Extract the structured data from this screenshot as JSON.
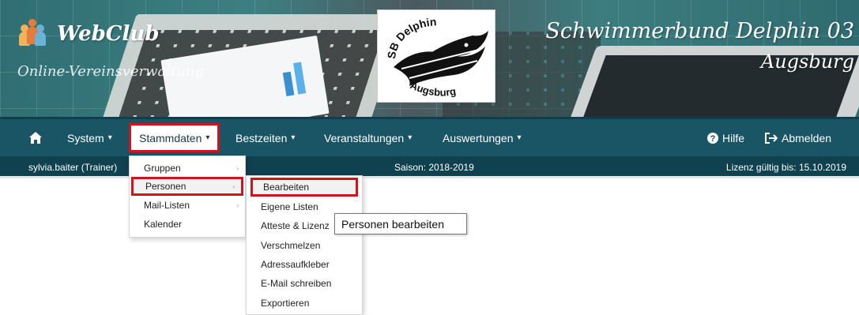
{
  "banner": {
    "app_name": "WebClub",
    "tagline": "Online-Vereinsverwaltung",
    "club_name": "Schwimmerbund Delphin 03",
    "club_city": "Augsburg",
    "logo_text_top": "SB Delphin",
    "logo_text_bottom": "Augsburg"
  },
  "nav": {
    "home_icon": "home-icon",
    "items": [
      {
        "label": "System",
        "caret": "▾"
      },
      {
        "label": "Stammdaten",
        "caret": "▾"
      },
      {
        "label": "Bestzeiten",
        "caret": "▾"
      },
      {
        "label": "Veranstaltungen",
        "caret": "▾"
      },
      {
        "label": "Auswertungen",
        "caret": "▾"
      }
    ],
    "hilfe": "Hilfe",
    "abmelden": "Abmelden"
  },
  "status": {
    "user": "sylvia.baiter (Trainer)",
    "saison": "Saison: 2018-2019",
    "lizenz": "Lizenz gültig bis: 15.10.2019"
  },
  "stammdaten_menu": {
    "items": [
      {
        "label": "Gruppen",
        "has_sub": true
      },
      {
        "label": "Personen",
        "has_sub": true
      },
      {
        "label": "Mail-Listen",
        "has_sub": true
      },
      {
        "label": "Kalender",
        "has_sub": false
      }
    ]
  },
  "personen_menu": {
    "items": [
      {
        "label": "Bearbeiten"
      },
      {
        "label": "Eigene Listen"
      },
      {
        "label": "Atteste & Lizenz"
      },
      {
        "label": "Verschmelzen"
      },
      {
        "label": "Adressaufkleber"
      },
      {
        "label": "E-Mail schreiben"
      },
      {
        "label": "Exportieren"
      }
    ]
  },
  "tooltip": "Personen bearbeiten",
  "colors": {
    "nav_bg": "#1a5566",
    "status_bg": "#10414e",
    "highlight": "#d0141e"
  }
}
